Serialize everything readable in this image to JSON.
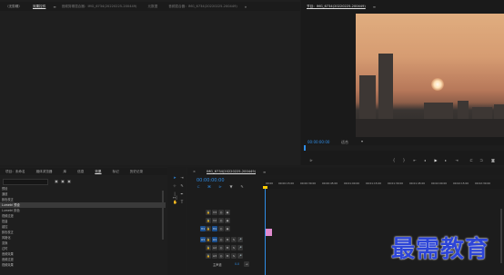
{
  "source_panel_tabs": [
    {
      "label": "（无剪辑）",
      "active": false
    },
    {
      "label": "效果控件",
      "active": true
    },
    {
      "label": "音频剪辑混合器：IMG_6734(20220225-200449)",
      "active": false
    },
    {
      "label": "元数据",
      "active": false
    },
    {
      "label": "音频混合器：IMG_6734(20220225-200449)",
      "active": false
    }
  ],
  "program_title": "节目：IMG_6734(20220225-200449)",
  "program": {
    "timecode": "00:00:00:00",
    "fit": "适合",
    "controls": [
      "mark-in",
      "mark-out",
      "go-to-in",
      "step-back",
      "play",
      "step-forward",
      "go-to-out",
      "insert",
      "overwrite",
      "export-frame"
    ]
  },
  "effects_panel": {
    "tabs": [
      {
        "label": "项目：未命名",
        "active": false
      },
      {
        "label": "媒体浏览器",
        "active": false
      },
      {
        "label": "库",
        "active": false
      },
      {
        "label": "信息",
        "active": false
      },
      {
        "label": "效果",
        "active": true
      },
      {
        "label": "标记",
        "active": false
      },
      {
        "label": "历史记录",
        "active": false
      }
    ],
    "items": [
      {
        "label": "预设",
        "selected": false
      },
      {
        "label": "通道",
        "selected": false
      },
      {
        "label": "颜色校正",
        "selected": false
      },
      {
        "label": "Lumetri 预设",
        "selected": true
      },
      {
        "label": "Lumetri 颜色",
        "selected": false
      },
      {
        "label": "视频过渡",
        "selected": false
      },
      {
        "label": "扭曲",
        "selected": false
      },
      {
        "label": "键控",
        "selected": false
      },
      {
        "label": "颜色校正",
        "selected": false
      },
      {
        "label": "风格化",
        "selected": false
      },
      {
        "label": "变换",
        "selected": false
      },
      {
        "label": "过时",
        "selected": false
      },
      {
        "label": "音频效果",
        "selected": false
      },
      {
        "label": "音频过渡",
        "selected": false
      },
      {
        "label": "视频效果",
        "selected": false
      }
    ]
  },
  "timeline": {
    "title": "IMG_6734(20220225-200449)",
    "timecode": "00:00:00:00",
    "ruler_labels": [
      "00:00",
      "00:00:15:00",
      "00:00:30:00",
      "00:00:45:00",
      "00:01:00:00",
      "00:01:15:00",
      "00:01:30:00",
      "00:01:45:00",
      "00:02:00:00",
      "00:02:15:00",
      "00:02:30:00"
    ],
    "tracks": [
      {
        "name": "V3",
        "type": "video"
      },
      {
        "name": "V2",
        "type": "video"
      },
      {
        "name": "V1",
        "type": "video"
      },
      {
        "name": "A1",
        "type": "audio"
      },
      {
        "name": "A2",
        "type": "audio"
      },
      {
        "name": "A3",
        "type": "audio"
      }
    ],
    "master_label": "主声道",
    "master_value": "0.0"
  },
  "watermark": "最需教育",
  "accent_color": "#2f8de6"
}
